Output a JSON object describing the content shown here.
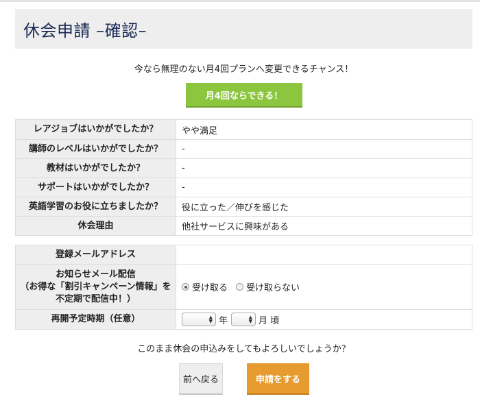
{
  "page": {
    "title": "休会申請 –確認–"
  },
  "promo": {
    "text": "今なら無理のない月4回プランへ変更できるチャンス！",
    "button_label": "月4回ならできる！"
  },
  "survey": [
    {
      "question": "レアジョブはいかがでしたか？",
      "answer": "やや満足"
    },
    {
      "question": "講師のレベルはいかがでしたか？",
      "answer": "-"
    },
    {
      "question": "教材はいかがでしたか？",
      "answer": "-"
    },
    {
      "question": "サポートはいかがでしたか？",
      "answer": "-"
    },
    {
      "question": "英語学習のお役に立ちましたか？",
      "answer": "役に立った／伸びを感じた"
    },
    {
      "question": "休会理由",
      "answer": "他社サービスに興味がある"
    }
  ],
  "contact": {
    "email_label": "登録メールアドレス",
    "email_value": "",
    "newsletter_label_1": "お知らせメール配信",
    "newsletter_label_2": "（お得な「割引キャンペーン情報」を",
    "newsletter_label_3": "不定期で配信中！）",
    "receive_label": "受け取る",
    "decline_label": "受け取らない",
    "receive_selected": true,
    "resume_label": "再開予定時期（任意）",
    "year_value": "",
    "year_unit": "年",
    "month_value": "",
    "month_unit": "月 頃"
  },
  "confirm": {
    "text": "このまま休会の申込みをしてもよろしいでしょうか？",
    "back_label": "前へ戻る",
    "submit_label": "申請をする"
  }
}
